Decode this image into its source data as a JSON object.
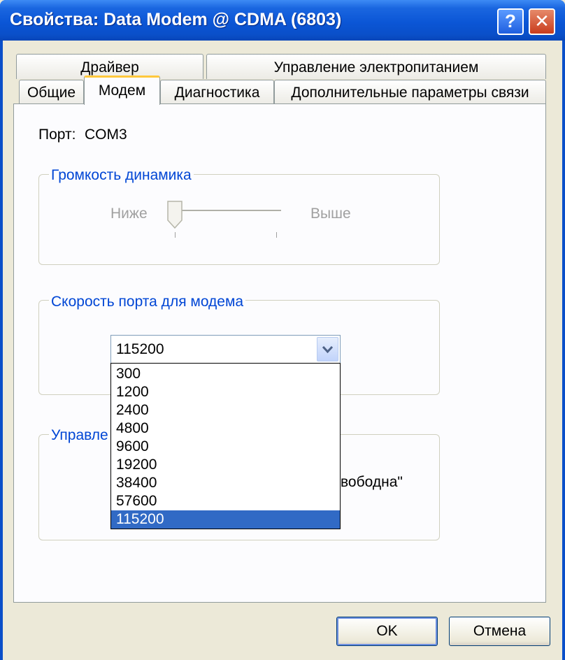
{
  "window": {
    "title": "Свойства: Data Modem @ CDMA (6803)",
    "help_button": "?",
    "close_button": "✕"
  },
  "tabs": {
    "row_back": [
      {
        "label": "Драйвер"
      },
      {
        "label": "Управление электропитанием"
      }
    ],
    "row_front": [
      {
        "label": "Общие"
      },
      {
        "label": "Модем",
        "active": true
      },
      {
        "label": "Диагностика"
      },
      {
        "label": "Дополнительные параметры связи"
      }
    ]
  },
  "port": {
    "label": "Порт:",
    "value": "COM3"
  },
  "volume_group": {
    "title": "Громкость динамика",
    "low_label": "Ниже",
    "high_label": "Выше",
    "level": 0,
    "enabled": false
  },
  "speed_group": {
    "title": "Скорость порта для модема",
    "selected": "115200",
    "options": [
      "300",
      "1200",
      "2400",
      "4800",
      "9600",
      "19200",
      "38400",
      "57600",
      "115200"
    ],
    "highlighted_index": 8
  },
  "control_group": {
    "title_visible": "Управле",
    "text_visible": "вободна\""
  },
  "buttons": {
    "ok": "OK",
    "cancel": "Отмена"
  },
  "colors": {
    "titlebar": "#0a56d6",
    "group_title": "#0046d5",
    "selection": "#316ac5",
    "active_tab_accent": "#ffc83c"
  }
}
